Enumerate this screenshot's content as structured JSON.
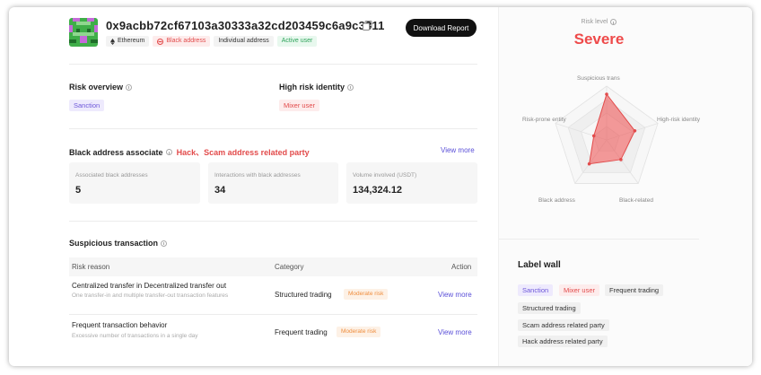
{
  "header": {
    "address": "0x9acbb72cf67103a30333a32cd203459c6a9c3311",
    "download_label": "Download Report",
    "tags": [
      {
        "label": "Ethereum",
        "icon": "ethereum-icon"
      },
      {
        "label": "Black address",
        "icon": "block-icon"
      },
      {
        "label": "Individual address"
      },
      {
        "label": "Active user"
      }
    ]
  },
  "risk_overview": {
    "title": "Risk overview",
    "chip": "Sanction"
  },
  "high_risk_identity": {
    "title": "High risk identity",
    "chip": "Mixer user"
  },
  "black_associate": {
    "title": "Black address associate",
    "highlight": "Hack、Scam address related party",
    "view_more": "View more",
    "stats": [
      {
        "label": "Associated black addresses",
        "value": "5"
      },
      {
        "label": "Interactions with black addresses",
        "value": "34"
      },
      {
        "label": "Volume involved (USDT)",
        "value": "134,324.12"
      }
    ]
  },
  "suspicious": {
    "title": "Suspicious transaction",
    "columns": [
      "Risk reason",
      "Category",
      "Action"
    ],
    "rows": [
      {
        "title": "Centralized transfer in Decentralized transfer out",
        "desc": "One transfer-in and multiple transfer-out transaction features",
        "category": "Structured trading",
        "risk": "Moderate risk",
        "action": "View more"
      },
      {
        "title": "Frequent transaction behavior",
        "desc": "Excessive number of transactions in a single day",
        "category": "Frequent trading",
        "risk": "Moderate risk",
        "action": "View more"
      }
    ]
  },
  "risk_level": {
    "label": "Risk level",
    "value": "Severe",
    "color": "#ee4a4a",
    "radar_axes": [
      "Suspicious trans",
      "High-risk identity",
      "Black-related",
      "Black address",
      "Risk-prone entity"
    ],
    "radar_values": [
      0.85,
      0.55,
      0.45,
      0.55,
      0.25
    ]
  },
  "label_wall": {
    "title": "Label wall",
    "labels": [
      "Sanction",
      "Mixer user",
      "Frequent trading",
      "Structured trading",
      "Scam address related party",
      "Hack address related party"
    ]
  }
}
